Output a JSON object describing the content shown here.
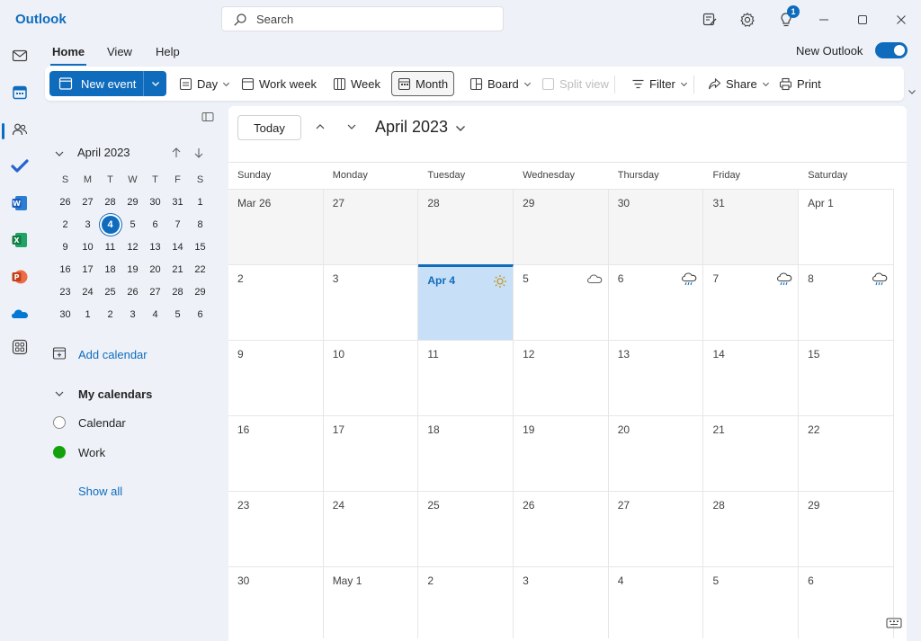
{
  "app": {
    "name": "Outlook"
  },
  "search": {
    "placeholder": "Search"
  },
  "titlebar": {
    "notification_count": "1"
  },
  "ribbon": {
    "tabs": [
      "Home",
      "View",
      "Help"
    ],
    "new_outlook_label": "New Outlook",
    "new_outlook_enabled": true,
    "new_event_label": "New event",
    "day_label": "Day",
    "work_week_label": "Work week",
    "week_label": "Week",
    "month_label": "Month",
    "board_label": "Board",
    "split_view_label": "Split view",
    "filter_label": "Filter",
    "share_label": "Share",
    "print_label": "Print"
  },
  "mini_calendar": {
    "title": "April 2023",
    "weekdays": [
      "S",
      "M",
      "T",
      "W",
      "T",
      "F",
      "S"
    ],
    "weeks": [
      [
        "26",
        "27",
        "28",
        "29",
        "30",
        "31",
        "1"
      ],
      [
        "2",
        "3",
        "4",
        "5",
        "6",
        "7",
        "8"
      ],
      [
        "9",
        "10",
        "11",
        "12",
        "13",
        "14",
        "15"
      ],
      [
        "16",
        "17",
        "18",
        "19",
        "20",
        "21",
        "22"
      ],
      [
        "23",
        "24",
        "25",
        "26",
        "27",
        "28",
        "29"
      ],
      [
        "30",
        "1",
        "2",
        "3",
        "4",
        "5",
        "6"
      ]
    ],
    "today": "4"
  },
  "left": {
    "add_calendar_label": "Add calendar",
    "my_calendars_label": "My calendars",
    "calendars": [
      {
        "name": "Calendar",
        "checked": false
      },
      {
        "name": "Work",
        "checked": true,
        "color": "#13a10e"
      }
    ],
    "show_all_label": "Show all"
  },
  "main": {
    "today_label": "Today",
    "month_title": "April 2023",
    "weekdays": [
      "Sunday",
      "Monday",
      "Tuesday",
      "Wednesday",
      "Thursday",
      "Friday",
      "Saturday"
    ],
    "weeks": [
      [
        {
          "label": "Mar 26",
          "muted": true
        },
        {
          "label": "27",
          "muted": true
        },
        {
          "label": "28",
          "muted": true
        },
        {
          "label": "29",
          "muted": true
        },
        {
          "label": "30",
          "muted": true
        },
        {
          "label": "31",
          "muted": true
        },
        {
          "label": "Apr 1"
        }
      ],
      [
        {
          "label": "2"
        },
        {
          "label": "3"
        },
        {
          "label": "Apr 4",
          "today": true,
          "weather": "sun-icon"
        },
        {
          "label": "5",
          "weather": "cloud-icon"
        },
        {
          "label": "6",
          "weather": "rain-cloud-icon"
        },
        {
          "label": "7",
          "weather": "rain-cloud-icon"
        },
        {
          "label": "8",
          "weather": "rain-cloud-icon"
        }
      ],
      [
        {
          "label": "9"
        },
        {
          "label": "10"
        },
        {
          "label": "11"
        },
        {
          "label": "12"
        },
        {
          "label": "13"
        },
        {
          "label": "14"
        },
        {
          "label": "15"
        }
      ],
      [
        {
          "label": "16"
        },
        {
          "label": "17"
        },
        {
          "label": "18"
        },
        {
          "label": "19"
        },
        {
          "label": "20"
        },
        {
          "label": "21"
        },
        {
          "label": "22"
        }
      ],
      [
        {
          "label": "23"
        },
        {
          "label": "24"
        },
        {
          "label": "25"
        },
        {
          "label": "26"
        },
        {
          "label": "27"
        },
        {
          "label": "28"
        },
        {
          "label": "29"
        }
      ],
      [
        {
          "label": "30"
        },
        {
          "label": "May 1"
        },
        {
          "label": "2"
        },
        {
          "label": "3"
        },
        {
          "label": "4"
        },
        {
          "label": "5"
        },
        {
          "label": "6"
        }
      ]
    ]
  },
  "colors": {
    "accent": "#0f6cbd",
    "today_bg": "#c7dff7",
    "muted_bg": "#f5f5f5",
    "work_calendar": "#13a10e"
  }
}
